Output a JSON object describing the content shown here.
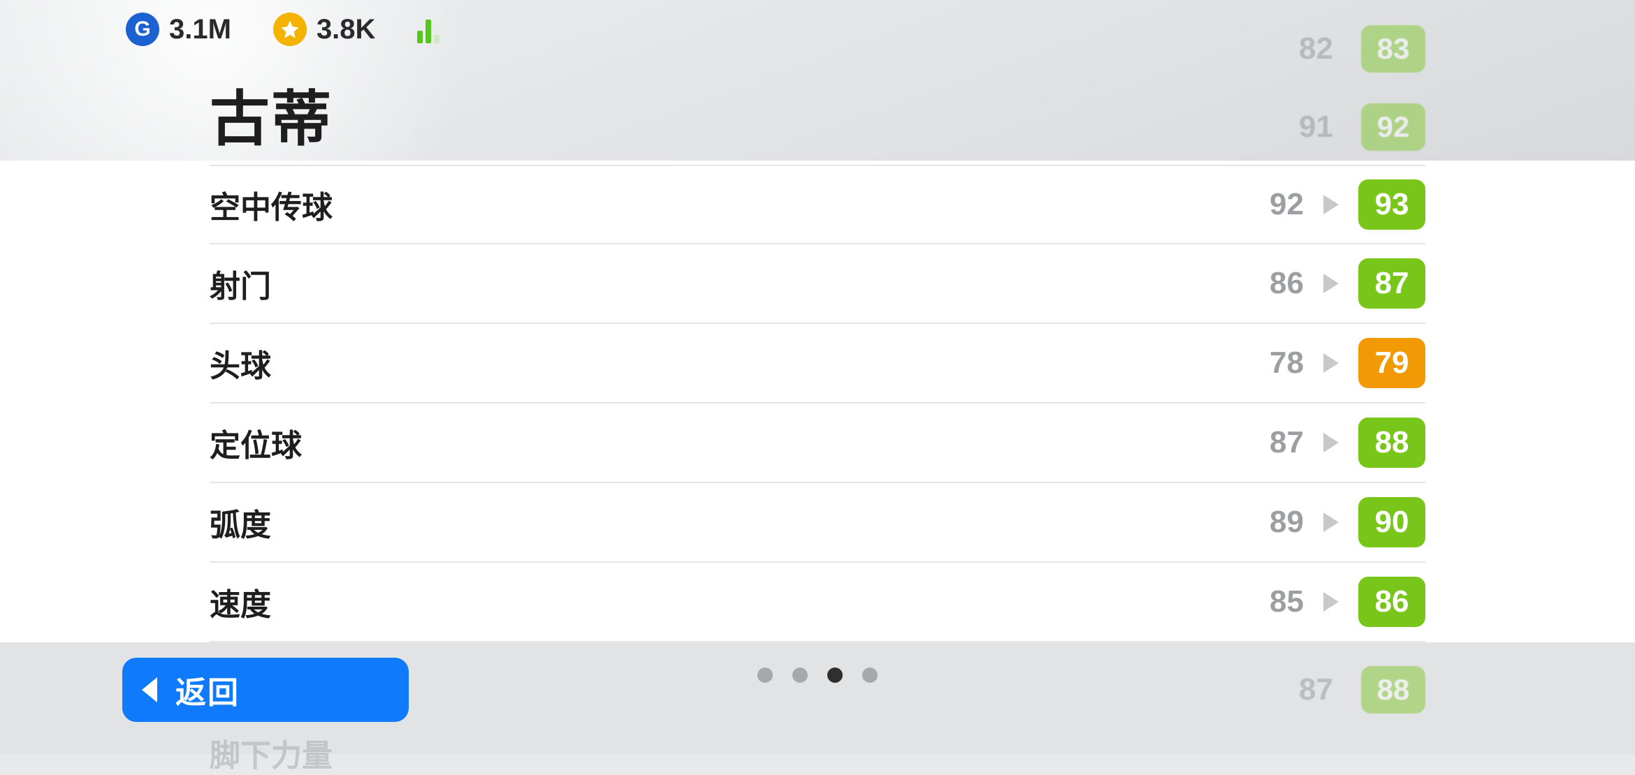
{
  "currencies": {
    "g_symbol": "G",
    "g_value": "3.1M",
    "star_value": "3.8K"
  },
  "player_name": "古蒂",
  "stats": [
    {
      "label": "空中传球",
      "old": "92",
      "new": "93",
      "tier": "green"
    },
    {
      "label": "射门",
      "old": "86",
      "new": "87",
      "tier": "green"
    },
    {
      "label": "头球",
      "old": "78",
      "new": "79",
      "tier": "orange"
    },
    {
      "label": "定位球",
      "old": "87",
      "new": "88",
      "tier": "green"
    },
    {
      "label": "弧度",
      "old": "89",
      "new": "90",
      "tier": "green"
    },
    {
      "label": "速度",
      "old": "85",
      "new": "86",
      "tier": "green"
    }
  ],
  "ghost_stats_top": [
    {
      "old": "82",
      "new": "83"
    },
    {
      "old": "91",
      "new": "92"
    }
  ],
  "ghost_stats_bottom": {
    "label_partial": "脚下力量",
    "old": "87",
    "new": "88"
  },
  "pagination": {
    "count": 4,
    "active_index": 2
  },
  "back_label": "返回"
}
